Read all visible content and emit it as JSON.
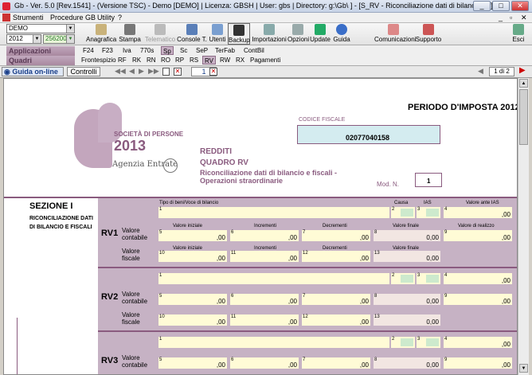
{
  "window": {
    "title": "Gb - Ver. 5.0 [Rev.1541] - (Versione TSC) - Demo [DEMO]   | Licenza: GBSH | User: gbs | Directory: g:\\Gb\\ ] - [S_RV - Riconciliazione dati di bilancio e f]"
  },
  "menu": {
    "items": [
      "Strumenti",
      "Procedure GB",
      "Utility",
      "?"
    ]
  },
  "left_combos": {
    "company": "DEMO",
    "year": "2012",
    "code": "256200 -"
  },
  "toolbar": {
    "buttons": [
      "Anagrafica",
      "Stampa",
      "Telematico",
      "Console T.",
      "Utenti",
      "Backup",
      "Importazioni",
      "Opzioni",
      "Update",
      "Guida",
      "Comunicazioni",
      "Supporto",
      "Esci"
    ]
  },
  "sidebar": {
    "applicazioni": "Applicazioni",
    "quadri": "Quadri"
  },
  "tabs_row1": [
    "F24",
    "F23",
    "Iva",
    "770s",
    "Sp",
    "Sc",
    "SeP",
    "TerFab",
    "ContBil"
  ],
  "tabs_row2": [
    "Frontespizio",
    "RF",
    "RK",
    "RN",
    "RO",
    "RP",
    "RS",
    "RV",
    "RW",
    "RX",
    "Pagamenti"
  ],
  "navbar": {
    "guida": "Guida on-line",
    "controlli": "Controlli",
    "page": "1",
    "pages": "1 di 2"
  },
  "form": {
    "logo_text": "SOCIETÀ DI PERSONE",
    "logo_year": "2013",
    "agency": "Agenzia Entrate",
    "periodo": "PERIODO D'IMPOSTA 2012",
    "cf_label": "CODICE FISCALE",
    "cf_value": "02077040158",
    "redditi": "REDDITI",
    "quadro": "QUADRO RV",
    "desc": "Riconciliazione dati di bilancio e fiscali - Operazioni straordinarie",
    "modn_label": "Mod. N.",
    "modn_value": "1",
    "sezione": "SEZIONE I",
    "sezione_desc": "RICONCILIAZIONE DATI DI BILANCIO E FISCALI",
    "side_label": "isteriale",
    "hdr": {
      "tipo": "Tipo di beni/Voce di bilancio",
      "causa": "Causa",
      "ias": "IAS",
      "valore_ante": "Valore ante IAS",
      "val_iniziale": "Valore iniziale",
      "incrementi": "Incrementi",
      "decrementi": "Decrementi",
      "val_finale": "Valore finale",
      "val_realizzo": "Valore di realizzo"
    },
    "valore_contabile": "Valore contabile",
    "valore_fiscale": "Valore fiscale",
    "rows": [
      "RV1",
      "RV2",
      "RV3"
    ],
    "zero": ",00",
    "zero_final": "0,00"
  },
  "colors": {
    "accent": "#8a5b7f",
    "field": "#fffbd6",
    "green": "#cdeacd"
  }
}
